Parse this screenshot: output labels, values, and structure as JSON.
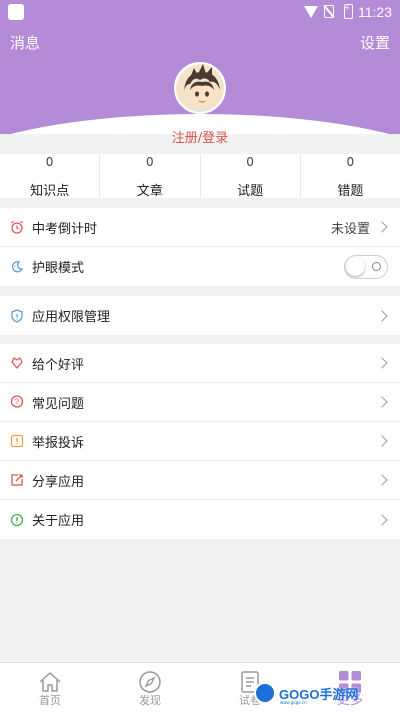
{
  "status_bar": {
    "time": "11:23"
  },
  "header": {
    "left_label": "消息",
    "right_label": "设置"
  },
  "profile": {
    "login_label": "注册/登录"
  },
  "stats": [
    {
      "value": "0",
      "label": "知识点"
    },
    {
      "value": "0",
      "label": "文章"
    },
    {
      "value": "0",
      "label": "试题"
    },
    {
      "value": "0",
      "label": "错题"
    }
  ],
  "settings": {
    "countdown": {
      "label": "中考倒计时",
      "value": "未设置"
    },
    "eye_mode": {
      "label": "护眼模式",
      "enabled": false
    },
    "permissions": {
      "label": "应用权限管理"
    }
  },
  "menu": [
    {
      "label": "给个好评",
      "icon": "heart-icon",
      "color": "#e05555"
    },
    {
      "label": "常见问题",
      "icon": "question-icon",
      "color": "#e05555"
    },
    {
      "label": "举报投诉",
      "icon": "warning-icon",
      "color": "#e8a33d"
    },
    {
      "label": "分享应用",
      "icon": "share-icon",
      "color": "#e05555"
    },
    {
      "label": "关于应用",
      "icon": "info-icon",
      "color": "#4caf50"
    }
  ],
  "tabs": [
    {
      "label": "首页",
      "icon": "home-icon",
      "active": false
    },
    {
      "label": "发现",
      "icon": "compass-icon",
      "active": false
    },
    {
      "label": "试卷",
      "icon": "paper-icon",
      "active": false
    },
    {
      "label": "更多",
      "icon": "grid-icon",
      "active": true
    }
  ],
  "watermark": {
    "text": "GOGO手游网",
    "sub": "www.gogo.cn"
  },
  "colors": {
    "accent": "#b48bd6",
    "danger": "#d9534f"
  }
}
